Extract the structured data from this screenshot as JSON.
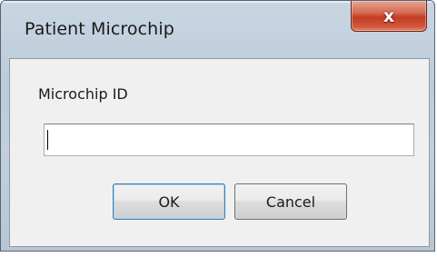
{
  "window": {
    "title": "Patient Microchip",
    "close_glyph": "x"
  },
  "form": {
    "label": "Microchip ID",
    "value": "",
    "placeholder": ""
  },
  "buttons": {
    "ok_label": "OK",
    "cancel_label": "Cancel"
  },
  "colors": {
    "titlebar": "#c2cfdb",
    "close_button": "#c23c22",
    "client": "#f0f0f0",
    "default_button_border": "#3c7fb1"
  },
  "icons": {
    "close": "close-icon"
  }
}
